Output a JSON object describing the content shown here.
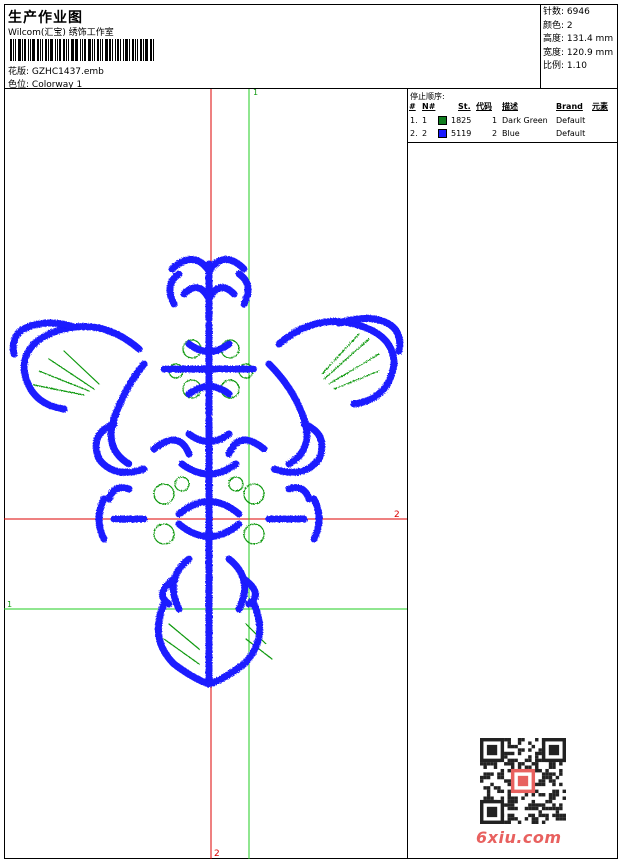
{
  "header": {
    "title": "生产作业图",
    "subtitle": "Wilcom(汇宝) 绣饰工作室",
    "design_label": "花版:",
    "design_value": "GZHC1437.emb",
    "colorway_label": "色位:",
    "colorway_value": "Colorway 1"
  },
  "stats": [
    {
      "label": "针数:",
      "value": "6946"
    },
    {
      "label": "颜色:",
      "value": "2"
    },
    {
      "label": "高度:",
      "value": "131.4 mm"
    },
    {
      "label": "宽度:",
      "value": "120.9 mm"
    },
    {
      "label": "比例:",
      "value": "1.10"
    }
  ],
  "stop_sequence": {
    "label": "停止顺序:",
    "headers": [
      "#",
      "N#",
      "St.",
      "代码",
      "描述",
      "Brand",
      "元素"
    ],
    "rows": [
      {
        "index": "1.",
        "n": "1",
        "color": "#0f7d1e",
        "stitches": "1825",
        "code": "1",
        "description": "Dark Green",
        "brand": "Default"
      },
      {
        "index": "2.",
        "n": "2",
        "color": "#1a1aff",
        "stitches": "5119",
        "code": "2",
        "description": "Blue",
        "brand": "Default"
      }
    ]
  },
  "axes": {
    "green_label_top": "1",
    "green_label_left": "1",
    "red_label_right": "2",
    "red_label_bottom": "2"
  },
  "colors": {
    "blue": "#1a1aff",
    "green": "#119911",
    "red_axis": "#dd0000",
    "green_axis": "#22cc22",
    "brand": "#e8615f"
  },
  "watermark": "6xiu.com"
}
